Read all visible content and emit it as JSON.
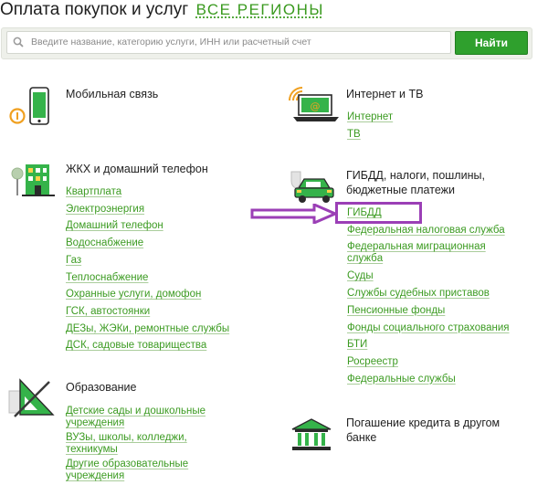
{
  "header": {
    "title": "Оплата покупок и услуг",
    "region_link": "ВСЕ РЕГИОНЫ"
  },
  "search": {
    "placeholder": "Введите название, категорию услуги, ИНН или расчетный счет",
    "button_label": "Найти"
  },
  "categories": {
    "mobile": {
      "title": "Мобильная связь",
      "icon": "phone-icon"
    },
    "internet": {
      "title": "Интернет и ТВ",
      "icon": "laptop-icon",
      "links": [
        "Интернет",
        "ТВ"
      ]
    },
    "housing": {
      "title": "ЖКХ и домашний телефон",
      "icon": "building-icon",
      "links": [
        "Квартплата",
        "Электроэнергия",
        "Домашний телефон",
        "Водоснабжение",
        "Газ",
        "Теплоснабжение",
        "Охранные услуги, домофон",
        "ГСК, автостоянки",
        "ДЕЗы, ЖЭКи, ремонтные службы",
        "ДСК, садовые товарищества"
      ]
    },
    "gibdd": {
      "title_line1": "ГИБДД, налоги, пошлины,",
      "title_line2": "бюджетные платежи",
      "icon": "car-icon",
      "links": [
        "ГИБДД",
        "Федеральная налоговая служба",
        "Федеральная миграционная",
        "службa",
        "Суды",
        "Службы судебных приставов",
        "Пенсионные фонды",
        "Фонды социального страхования",
        "БТИ",
        "Росреестр",
        "Федеральные службы"
      ]
    },
    "education": {
      "title": "Образование",
      "icon": "ruler-triangle-icon",
      "links": [
        "Детские сады и дошкольные",
        "учреждения",
        "ВУЗы, школы, колледжи,",
        "техникумы",
        "Другие образовательные",
        "учреждения"
      ]
    },
    "credit": {
      "title_line1": "Погашение кредита в другом",
      "title_line2": "банке",
      "icon": "bank-icon"
    }
  },
  "colors": {
    "accent_green": "#3c9b22",
    "button_green": "#2fa02d",
    "annotation_purple": "#9b3fb6"
  }
}
